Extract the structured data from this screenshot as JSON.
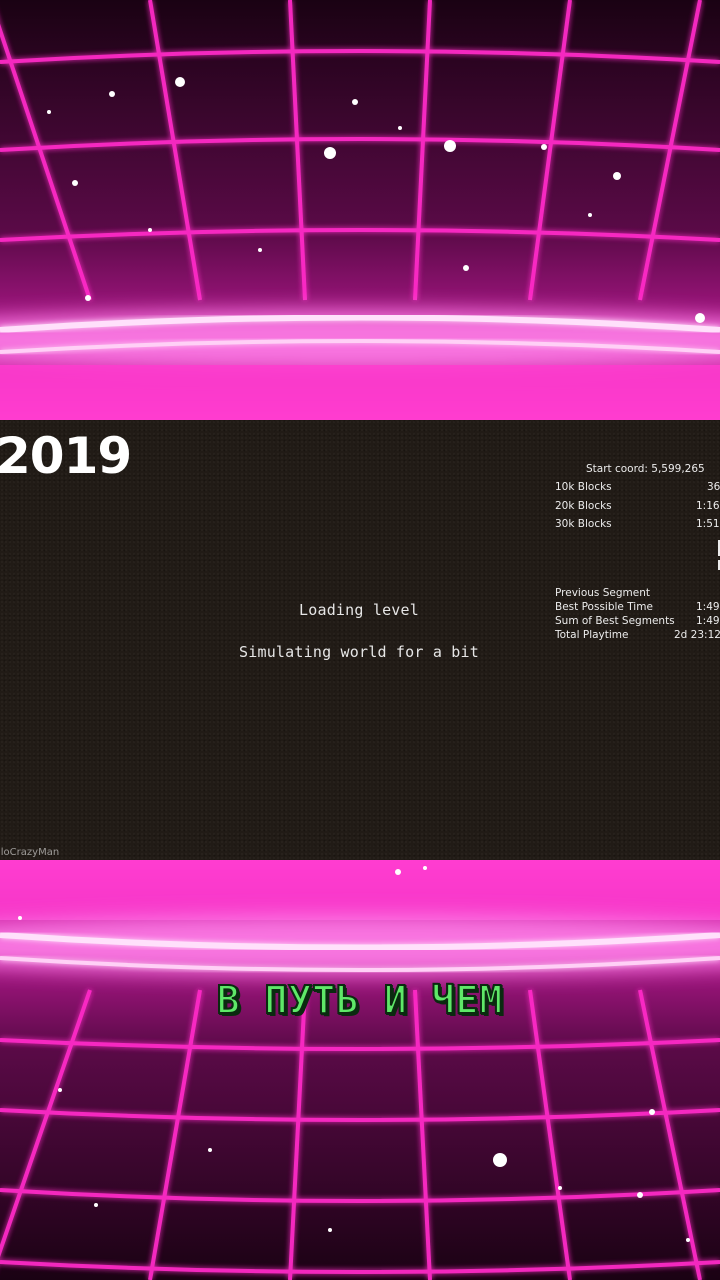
{
  "video": {
    "year": "2019",
    "watermark": "lloCrazyMan",
    "caption": "В ПУТЬ И ЧЕМ"
  },
  "loading": {
    "title": "Loading level",
    "subtitle": "Simulating world for a bit"
  },
  "timer": {
    "start_coord": "Start coord: 5,599,265",
    "splits": [
      {
        "label": "10k Blocks",
        "time": "36"
      },
      {
        "label": "20k Blocks",
        "time": "1:16"
      },
      {
        "label": "30k Blocks",
        "time": "1:51"
      }
    ],
    "stats": [
      {
        "label": "Previous Segment",
        "value": ""
      },
      {
        "label": "Best Possible Time",
        "value": "1:49"
      },
      {
        "label": "Sum of Best Segments",
        "value": "1:49"
      },
      {
        "label": "Total Playtime",
        "value": "2d 23:12"
      }
    ]
  },
  "colors": {
    "neon_grid": "#ff2bc8",
    "neon_glow": "#ff9cf0",
    "panel_bg": "#211b16",
    "caption_fill": "#5fe868",
    "caption_outline": "#0b2a10"
  }
}
